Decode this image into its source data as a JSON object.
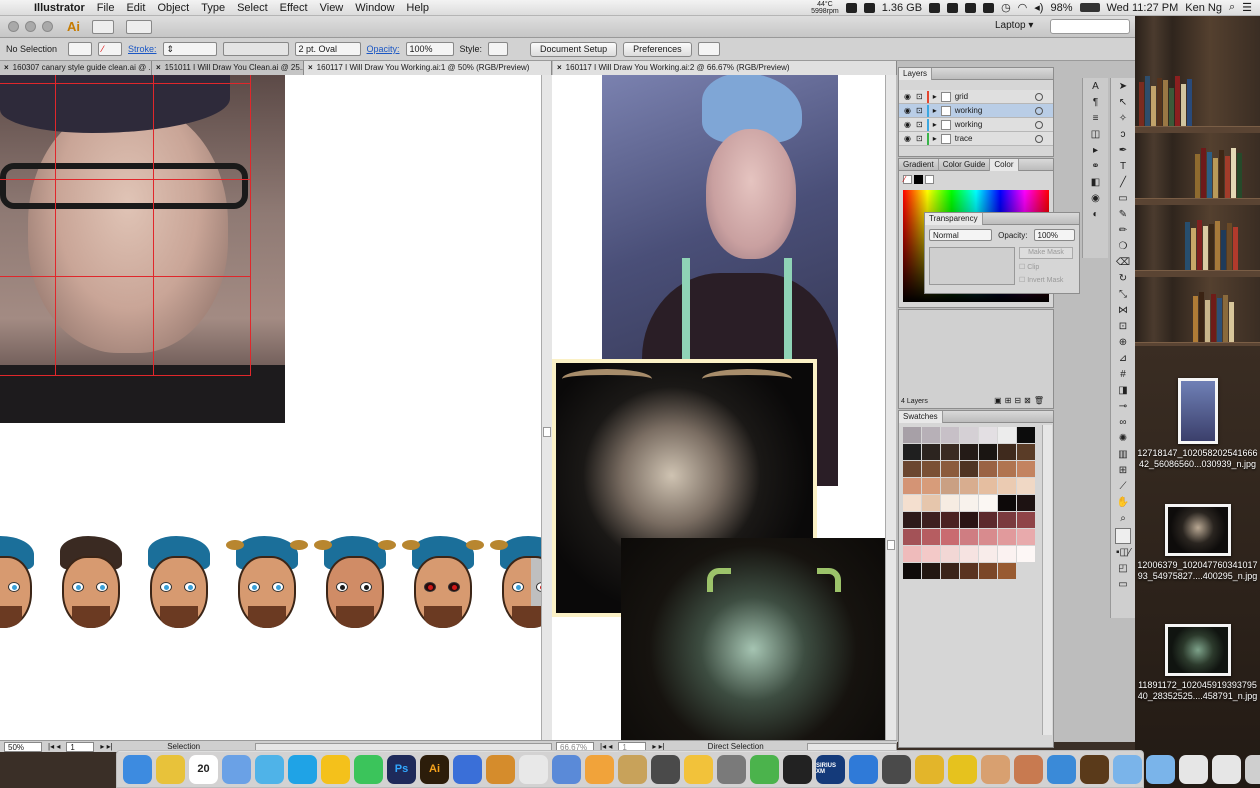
{
  "menubar": {
    "app_name": "Illustrator",
    "menus": [
      "File",
      "Edit",
      "Object",
      "Type",
      "Select",
      "Effect",
      "View",
      "Window",
      "Help"
    ],
    "temp": "44°C",
    "fan": "5998rpm",
    "memory": "1.36 GB",
    "battery": "98%",
    "clock": "Wed 11:27 PM",
    "user": "Ken Ng"
  },
  "app": {
    "logo": "Ai",
    "workspace": "Laptop"
  },
  "control": {
    "selection": "No Selection",
    "stroke_label": "Stroke:",
    "brush": "2 pt. Oval",
    "opacity_label": "Opacity:",
    "opacity_value": "100%",
    "style_label": "Style:",
    "doc_setup": "Document Setup",
    "preferences": "Preferences"
  },
  "tabs_left": [
    {
      "label": "160307 canary style guide clean.ai @ ..."
    },
    {
      "label": "151011 I Will Draw You Clean.ai @ 25..."
    },
    {
      "label": "160117 I Will Draw You Working.ai:1 @ 50% (RGB/Preview)"
    }
  ],
  "tab_right": "160117 I Will Draw You Working.ai:2 @ 66.67% (RGB/Preview)",
  "status_left": {
    "zoom": "50%",
    "page": "1",
    "tool": "Selection"
  },
  "status_right": {
    "zoom": "66.67%",
    "page": "1",
    "tool": "Direct Selection"
  },
  "layers": {
    "title": "Layers",
    "rows": [
      {
        "name": "grid",
        "color": "#e4462f"
      },
      {
        "name": "working",
        "color": "#3aa7e0"
      },
      {
        "name": "working",
        "color": "#3aa7e0"
      },
      {
        "name": "trace",
        "color": "#38b449"
      }
    ],
    "count": "4 Layers"
  },
  "color_panel": {
    "tabs": [
      "Gradient",
      "Color Guide",
      "Color"
    ]
  },
  "transparency": {
    "title": "Transparency",
    "mode": "Normal",
    "opacity_label": "Opacity:",
    "opacity": "100%",
    "make_mask": "Make Mask",
    "clip": "Clip",
    "invert": "Invert Mask"
  },
  "swatches": {
    "title": "Swatches",
    "colors": [
      "#a7a0a7",
      "#b7b0b7",
      "#c7c0c7",
      "#d5d0d5",
      "#e3dfe3",
      "#ececec",
      "#0c0c0c",
      "#1f1f1f",
      "#2c241f",
      "#3a2b22",
      "#241b17",
      "#1a1512",
      "#3f2a1d",
      "#5a3c27",
      "#6b4630",
      "#7a5035",
      "#8b5b3c",
      "#4f3423",
      "#9a6344",
      "#b07450",
      "#c38360",
      "#d49475",
      "#d79c7a",
      "#caa083",
      "#d8ad8f",
      "#e5bea0",
      "#ebcbb2",
      "#f0d8c5",
      "#f4dfcf",
      "#e6c6ac",
      "#f6ece2",
      "#f8f2ec",
      "#fbf7f3",
      "#0d0909",
      "#1d1212",
      "#2d1a1a",
      "#3d1f1f",
      "#4a2222",
      "#2a1414",
      "#5c2a2d",
      "#7a3a3e",
      "#8f4448",
      "#a35257",
      "#b65d61",
      "#c96b70",
      "#cf7d82",
      "#d88b8e",
      "#e19a9c",
      "#e8aaac",
      "#efbbbb",
      "#f3c9c8",
      "#f2d7d5",
      "#f6e3e1",
      "#f8ecea",
      "#fbf2f1",
      "#fdf7f6",
      "#0f0b0a",
      "#231712",
      "#3a2319",
      "#5a3320",
      "#7b4728",
      "#985a31"
    ]
  },
  "desktop_files": [
    {
      "name": "12718147_102058202541666 42_56086560...030939_n.jpg"
    },
    {
      "name": "12006379_102047760341017 93_54975827....400295_n.jpg"
    },
    {
      "name": "11891172_102045919393795 40_28352525....458791_n.jpg"
    }
  ],
  "dock": {
    "apps": [
      "finder-icon",
      "chrome-icon",
      "calendar-icon",
      "preview-icon",
      "messages-icon",
      "skype-icon",
      "slides-icon",
      "facetime-icon",
      "photoshop-icon",
      "illustrator-icon",
      "keynote-icon",
      "burger-icon",
      "mail-icon",
      "photo-icon",
      "sketch-icon",
      "home-icon",
      "movie-icon",
      "pineapple-icon",
      "system-prefs-icon",
      "sync-icon",
      "terminal-icon",
      "siriusxm-icon",
      "globe-icon",
      "maps-icon",
      "game-icon",
      "helmet-icon",
      "avatar-icon",
      "avatar2-icon",
      "bird-icon",
      "cat-icon",
      "folder-icon",
      "folder2-icon",
      "preview2-icon",
      "display-icon",
      "trash-icon"
    ],
    "calendar_day": "20",
    "illustrator_label": "Ai",
    "photoshop_label": "Ps",
    "sirius_label": "SIRIUS XM"
  }
}
